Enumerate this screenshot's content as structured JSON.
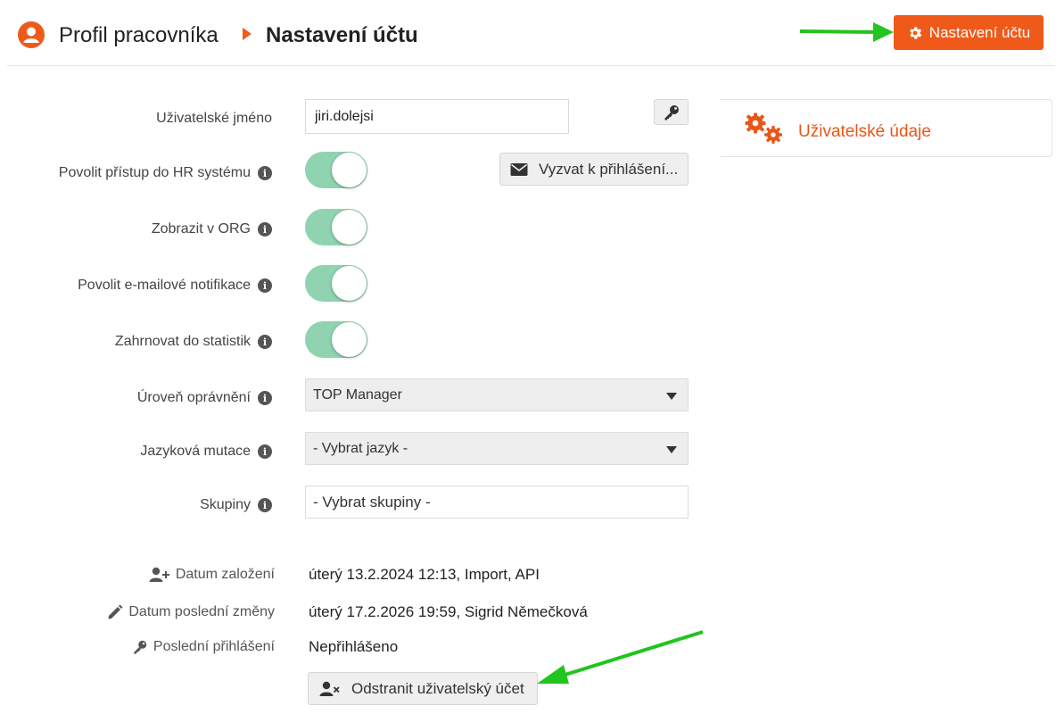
{
  "header": {
    "breadcrumb_profile": "Profil pracovníka",
    "breadcrumb_current": "Nastavení účtu",
    "account_button_label": "Nastavení účtu"
  },
  "form": {
    "username_label": "Uživatelské jméno",
    "username_value": "jiri.dolejsi",
    "hr_access_label": "Povolit přístup do HR systému",
    "hr_access_enabled": true,
    "invite_button_label": "Vyzvat k přihlášení...",
    "show_org_label": "Zobrazit v ORG",
    "show_org_enabled": true,
    "email_notif_label": "Povolit e-mailové notifikace",
    "email_notif_enabled": true,
    "stats_label": "Zahrnovat do statistik",
    "stats_enabled": true,
    "permission_label": "Úroveň oprávnění",
    "permission_value": "TOP Manager",
    "language_label": "Jazyková mutace",
    "language_value": "- Vybrat jazyk -",
    "groups_label": "Skupiny",
    "groups_placeholder": "- Vybrat skupiny -"
  },
  "meta": {
    "created_label": "Datum založení",
    "created_value": "úterý 13.2.2024 12:13, Import, API",
    "modified_label": "Datum poslední změny",
    "modified_value": "úterý 17.2.2026 19:59, Sigrid Němečková",
    "last_login_label": "Poslední přihlášení",
    "last_login_value": "Nepřihlášeno",
    "remove_button_label": "Odstranit uživatelský účet"
  },
  "side": {
    "user_data_label": "Uživatelské údaje"
  },
  "colors": {
    "accent_orange": "#ef5a1a",
    "toggle_on": "#8fd3b0",
    "annotation_arrow": "#22c41e"
  },
  "icons": {
    "profile": "user-circle-icon",
    "breadcrumb_separator": "caret-right-icon",
    "account_button": "gear-icon",
    "key": "key-icon",
    "envelope": "envelope-icon",
    "info": "info-icon",
    "user_plus": "user-plus-icon",
    "pencil": "pencil-icon",
    "user_remove": "user-times-icon",
    "gears": "gears-icon"
  }
}
